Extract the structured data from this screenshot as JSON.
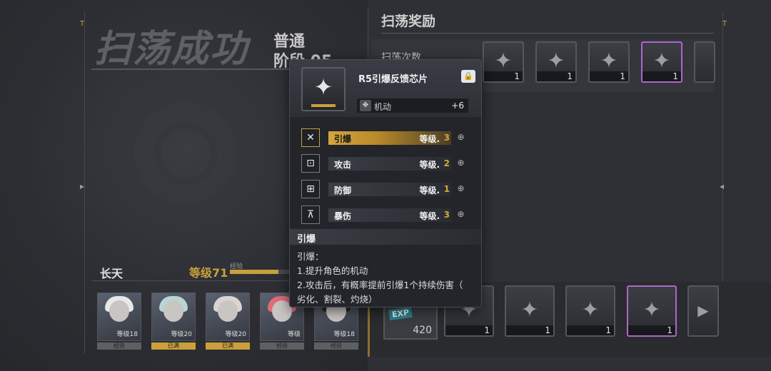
{
  "header": {
    "title": "扫荡成功",
    "mode": "普通",
    "stage": "阶段 05"
  },
  "rewards_panel": {
    "title": "扫荡奖励",
    "sweep_count_label": "扫荡次数",
    "top_items": [
      {
        "qty": "1",
        "rarity": "gray"
      },
      {
        "qty": "1",
        "rarity": "gray"
      },
      {
        "qty": "1",
        "rarity": "gray"
      },
      {
        "qty": "1",
        "rarity": "purple"
      }
    ],
    "bottom_exp": {
      "badge": "EXP",
      "qty": "420"
    },
    "bottom_items": [
      {
        "qty": "1",
        "rarity": "gray"
      },
      {
        "qty": "1",
        "rarity": "gray"
      },
      {
        "qty": "1",
        "rarity": "gray"
      },
      {
        "qty": "1",
        "rarity": "purple"
      }
    ]
  },
  "character": {
    "name": "长天",
    "level": "等级71",
    "exp_label": "经验",
    "exp_progress": 0.36
  },
  "portraits": [
    {
      "level": "等级18",
      "tag": "经验",
      "tag_style": "gray",
      "hair": "#e8e8e8"
    },
    {
      "level": "等级20",
      "tag": "已满",
      "tag_style": "gold",
      "hair": "#b9d6d3"
    },
    {
      "level": "等级20",
      "tag": "已满",
      "tag_style": "gold",
      "hair": "#d9d4d0"
    },
    {
      "level": "等级",
      "tag": "经验",
      "tag_style": "gray",
      "hair": "#e06c78"
    },
    {
      "level": "等级18",
      "tag": "经验",
      "tag_style": "gray",
      "hair": "#2c2724"
    }
  ],
  "tooltip": {
    "item_name": "R5引爆反馈芯片",
    "lock_icon": "lock-icon",
    "stat": {
      "label": "机动",
      "value": "+6"
    },
    "skills": [
      {
        "name": "引爆",
        "level_label": "等级.",
        "level": "3",
        "active": true,
        "icon": "burst-icon"
      },
      {
        "name": "攻击",
        "level_label": "等级.",
        "level": "2",
        "active": false,
        "icon": "attack-icon"
      },
      {
        "name": "防御",
        "level_label": "等级.",
        "level": "1",
        "active": false,
        "icon": "defense-icon"
      },
      {
        "name": "暴伤",
        "level_label": "等级.",
        "level": "3",
        "active": false,
        "icon": "crit-icon"
      }
    ],
    "desc_title": "引爆",
    "desc_lines": [
      "引爆：",
      "1.提升角色的机动",
      "2.攻击后，有概率提前引爆1个持续伤害（",
      "劣化、割裂、灼烧）"
    ]
  },
  "colors": {
    "accent_gold": "#c9a03c",
    "rarity_purple": "#b065c9"
  }
}
